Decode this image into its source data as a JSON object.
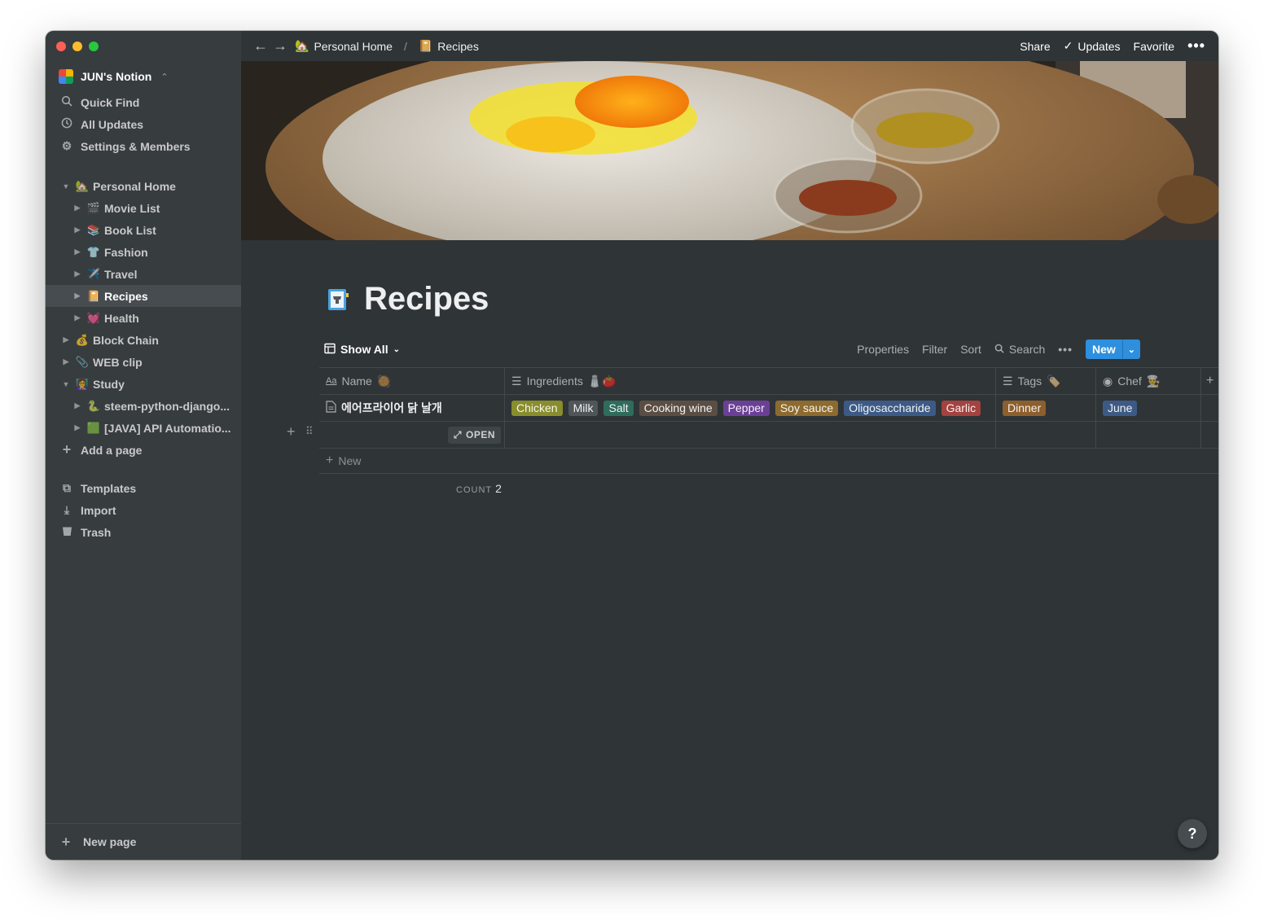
{
  "sidebar": {
    "workspace": "JUN's Notion",
    "nav": [
      {
        "label": "Quick Find",
        "icon": "search-icon"
      },
      {
        "label": "All Updates",
        "icon": "clock-icon"
      },
      {
        "label": "Settings & Members",
        "icon": "gear-icon"
      }
    ],
    "tree": [
      {
        "label": "Personal Home",
        "emoji": "🏡",
        "level": 0,
        "expanded": true
      },
      {
        "label": "Movie List",
        "emoji": "🎬",
        "level": 1
      },
      {
        "label": "Book List",
        "emoji": "📚",
        "level": 1
      },
      {
        "label": "Fashion",
        "emoji": "👕",
        "level": 1
      },
      {
        "label": "Travel",
        "emoji": "✈️",
        "level": 1
      },
      {
        "label": "Recipes",
        "emoji": "📔",
        "level": 1,
        "active": true
      },
      {
        "label": "Health",
        "emoji": "💓",
        "level": 1
      },
      {
        "label": "Block Chain",
        "emoji": "💰",
        "level": 0
      },
      {
        "label": "WEB clip",
        "emoji": "📎",
        "level": 0
      },
      {
        "label": "Study",
        "emoji": "👩‍🏫",
        "level": 0,
        "expanded": true
      },
      {
        "label": "steem-python-django...",
        "emoji": "🐍",
        "level": 1
      },
      {
        "label": "[JAVA] API Automatio...",
        "emoji": "🟩",
        "level": 1
      }
    ],
    "add_page": "Add a page",
    "bottom_nav": [
      {
        "label": "Templates",
        "icon": "templates-icon"
      },
      {
        "label": "Import",
        "icon": "import-icon"
      },
      {
        "label": "Trash",
        "icon": "trash-icon"
      }
    ],
    "new_page": "New page"
  },
  "topbar": {
    "breadcrumb": [
      {
        "label": "Personal Home",
        "emoji": "🏡"
      },
      {
        "label": "Recipes",
        "emoji": "📔"
      }
    ],
    "separator": "/",
    "share": "Share",
    "updates": "Updates",
    "favorite": "Favorite"
  },
  "page": {
    "title": "Recipes",
    "view": "Show All",
    "toolbar": {
      "properties": "Properties",
      "filter": "Filter",
      "sort": "Sort",
      "search": "Search",
      "new": "New"
    }
  },
  "table": {
    "columns": [
      {
        "name": "Name",
        "emoji": "🥘"
      },
      {
        "name": "Ingredients",
        "emoji": "🧂🍅"
      },
      {
        "name": "Tags",
        "emoji": "🏷️"
      },
      {
        "name": "Chef",
        "emoji": "👨‍🍳"
      }
    ],
    "rows": [
      {
        "name": "에어프라이어 닭 날개",
        "ingredients": [
          {
            "label": "Chicken",
            "color": "#898d2b"
          },
          {
            "label": "Milk",
            "color": "#4f5558"
          },
          {
            "label": "Salt",
            "color": "#2e6c5b"
          },
          {
            "label": "Cooking wine",
            "color": "#5a4e44"
          },
          {
            "label": "Pepper",
            "color": "#6b3f96"
          },
          {
            "label": "Soy sauce",
            "color": "#8d6a2e"
          },
          {
            "label": "Oligosaccharide",
            "color": "#3c5a85"
          },
          {
            "label": "Garlic",
            "color": "#a3423f"
          }
        ],
        "tags": [
          {
            "label": "Dinner",
            "color": "#8d5f2c"
          }
        ],
        "chef": [
          {
            "label": "June",
            "color": "#3c5a85"
          }
        ]
      }
    ],
    "open_label": "OPEN",
    "new_row": "New",
    "count_label": "COUNT",
    "count_value": "2"
  },
  "help": "?"
}
